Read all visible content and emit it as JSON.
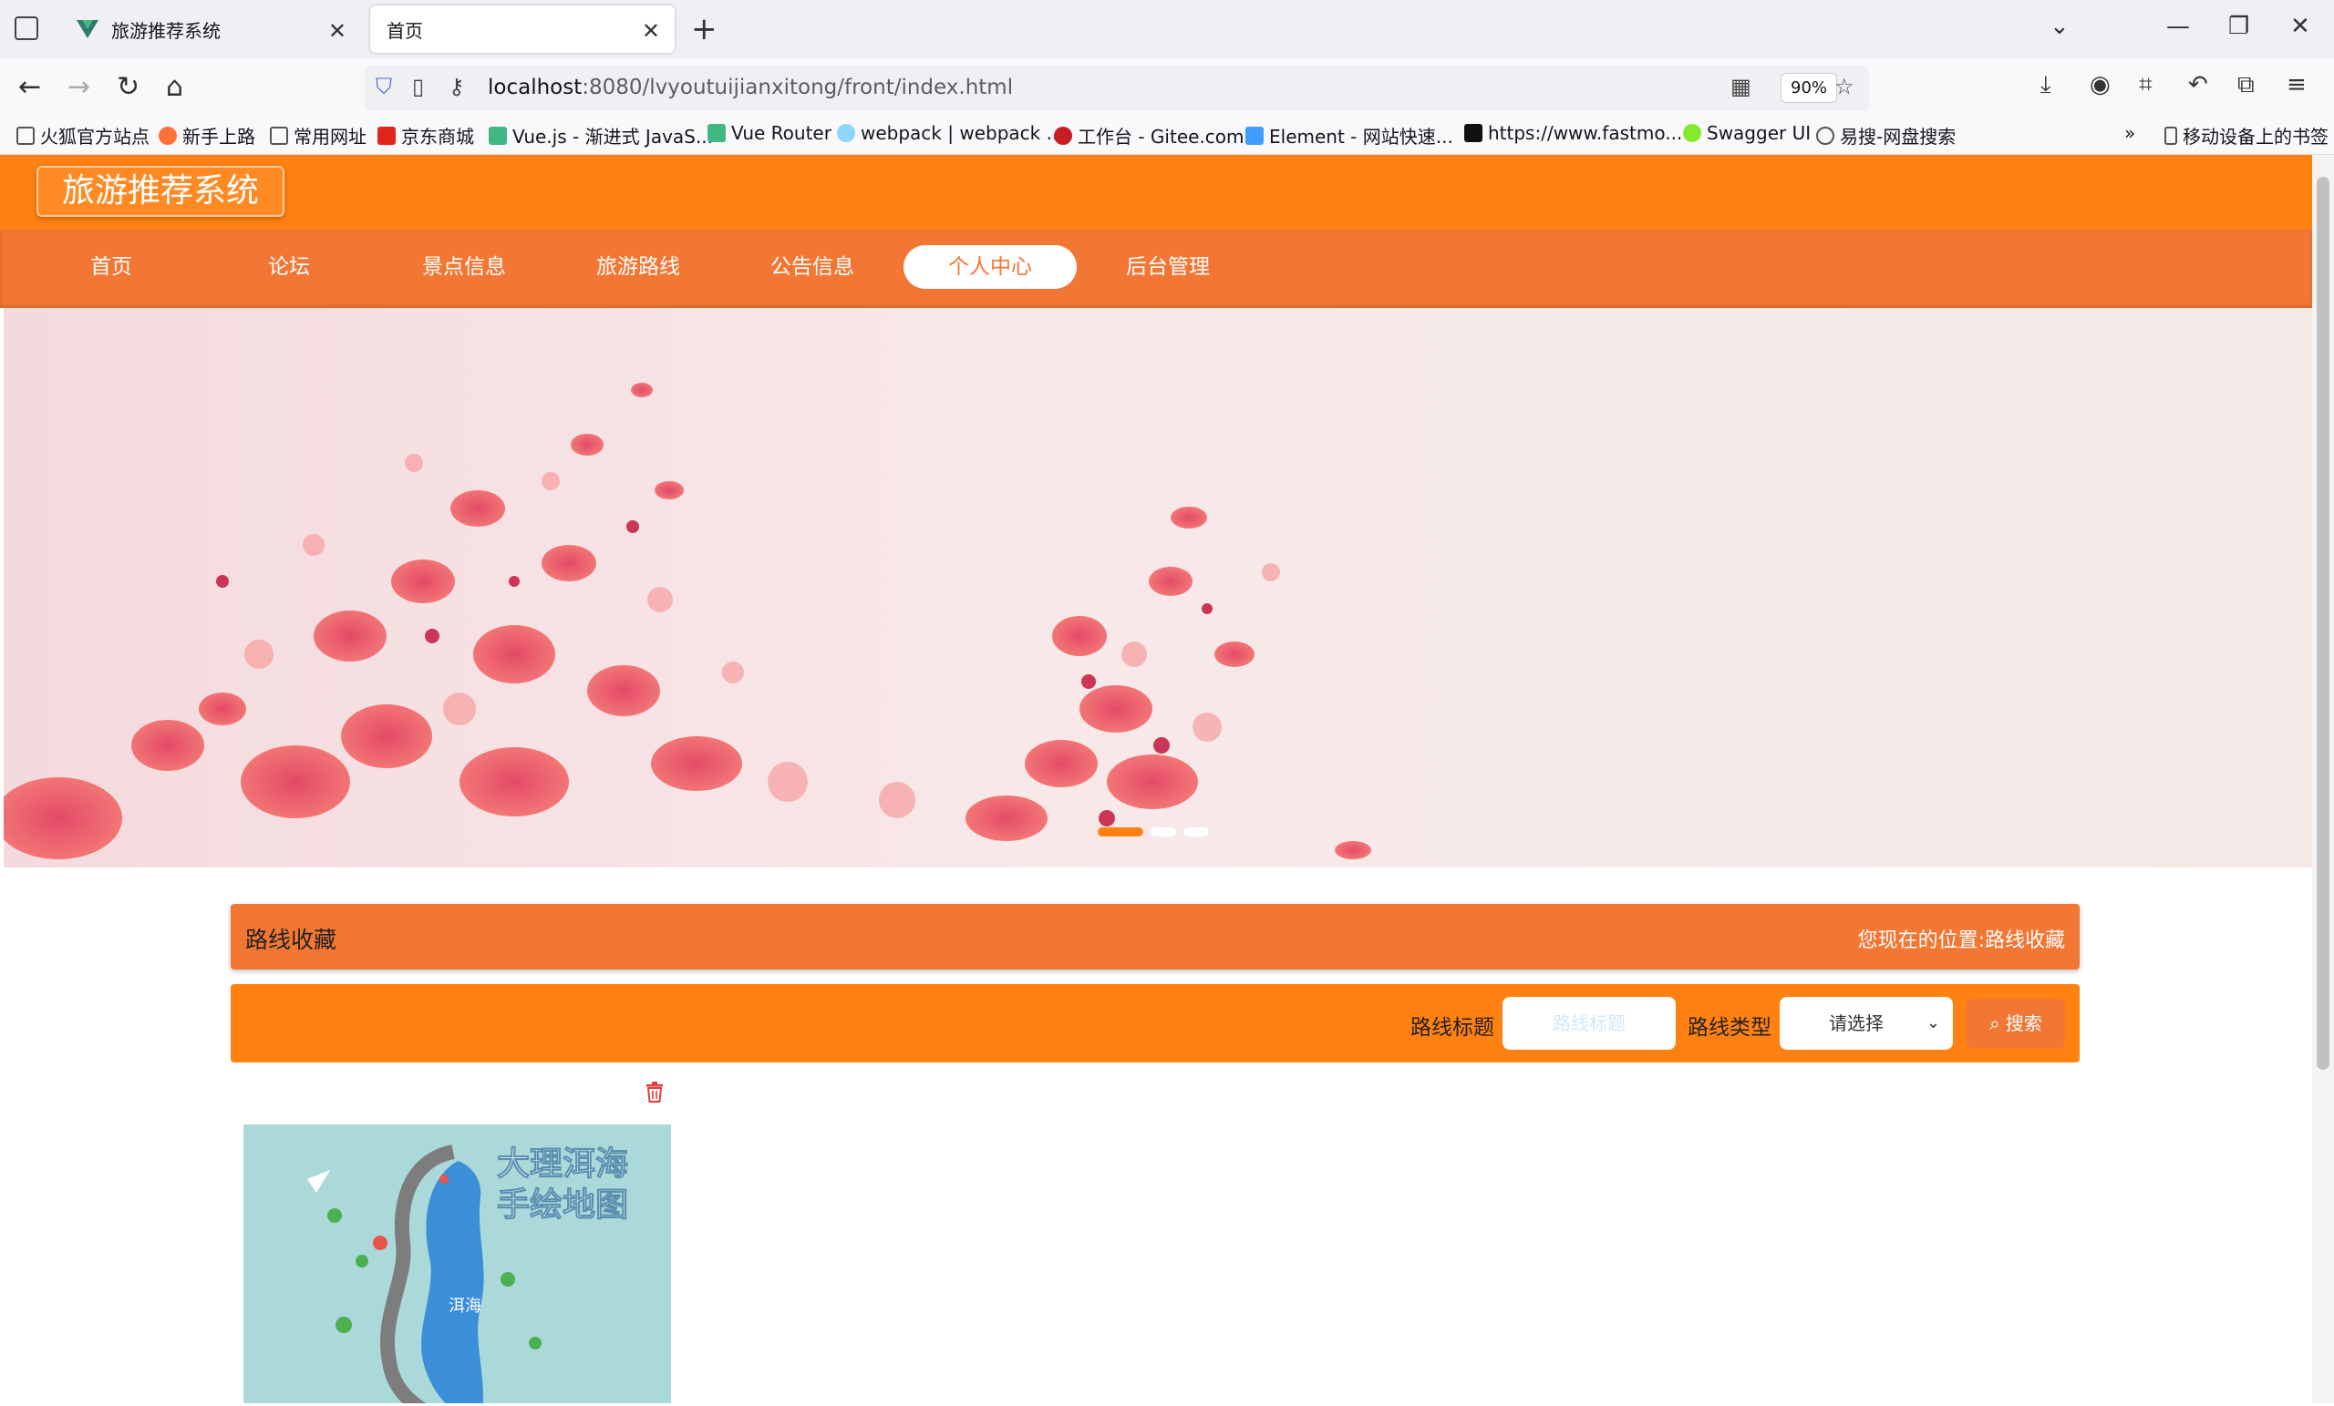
{
  "browser": {
    "tabs": [
      {
        "title": "旅游推荐系统"
      },
      {
        "title": "首页"
      }
    ],
    "url": {
      "host": "localhost",
      "path": ":8080/lvyoutuijianxitong/front/index.html"
    },
    "zoom": "90%",
    "bookmarks": [
      "火狐官方站点",
      "新手上路",
      "常用网址",
      "京东商城",
      "Vue.js - 渐进式 JavaS...",
      "Vue Router",
      "webpack | webpack ...",
      "工作台 - Gitee.com",
      "Element - 网站快速...",
      "https://www.fastmo...",
      "Swagger UI",
      "易搜-网盘搜索"
    ],
    "mobile_bookmarks": "移动设备上的书签"
  },
  "site": {
    "title": "旅游推荐系统",
    "menu": [
      "首页",
      "论坛",
      "景点信息",
      "旅游路线",
      "公告信息",
      "个人中心",
      "后台管理"
    ],
    "active_menu": "个人中心",
    "carousel_active_index": 0,
    "carousel_count": 3
  },
  "section": {
    "title": "路线收藏",
    "location_label": "您现在的位置:",
    "location_value": "路线收藏"
  },
  "search": {
    "title_label": "路线标题",
    "title_placeholder": "路线标题",
    "type_label": "路线类型",
    "type_selected": "请选择",
    "button": "搜索"
  },
  "card": {
    "map_title_line1": "大理洱海",
    "map_title_line2": "手绘地图",
    "map_label": "洱海"
  },
  "colors": {
    "header": "#ff8112",
    "menu": "#f27634",
    "accent": "#ff8112"
  }
}
